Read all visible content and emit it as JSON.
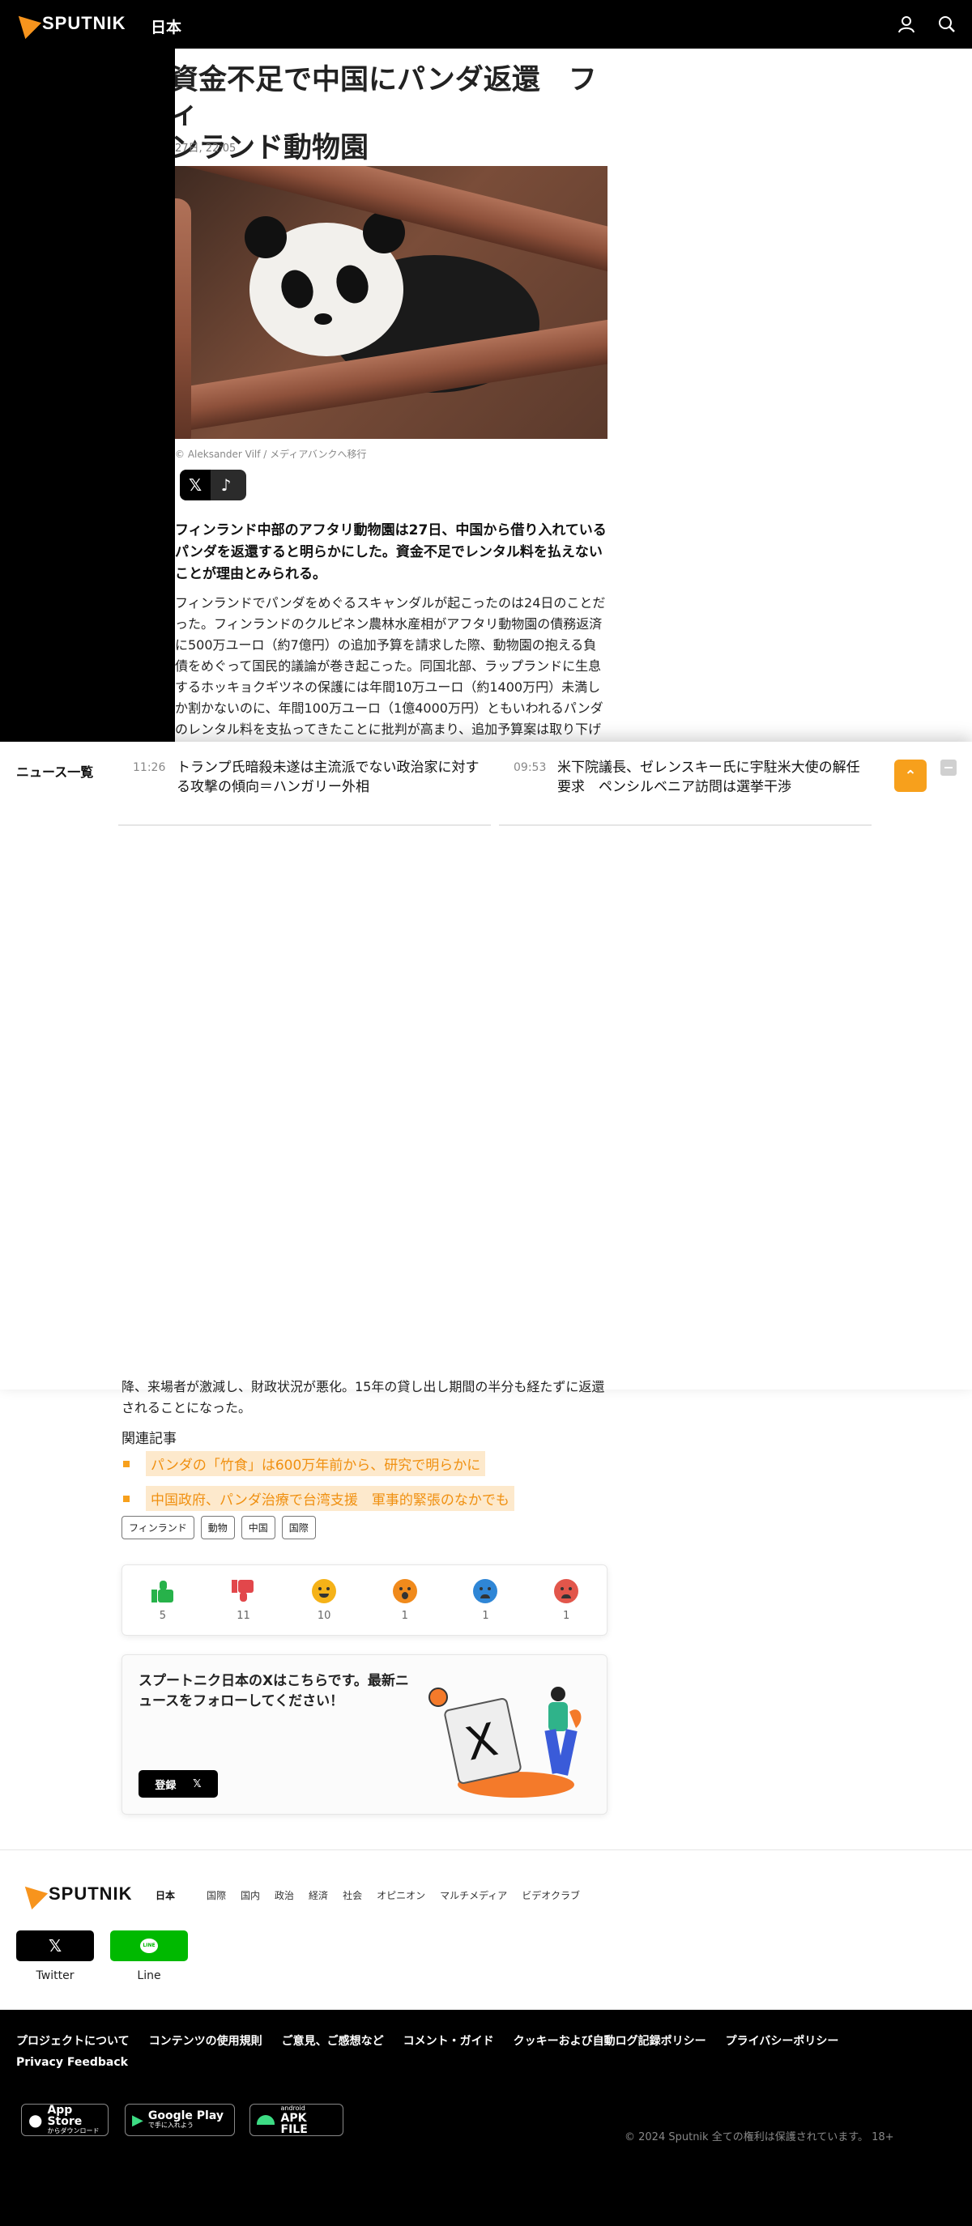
{
  "header": {
    "brand": "SPUTNIK",
    "edition": "日本",
    "user_icon": "user-icon",
    "search_icon": "search-icon"
  },
  "article": {
    "title_line1": "資金不足で中国にパンダ返還　フィ",
    "title_line2": "ンランド動物園",
    "date": "27日, 22:05",
    "caption": "© Aleksander Vilf / メディアバンクへ移行",
    "lead": "フィンランド中部のアフタリ動物園は27日、中国から借り入れているパンダを返還すると明らかにした。資金不足でレンタル料を払えないことが理由とみられる。",
    "body": "フィンランドでパンダをめぐるスキャンダルが起こったのは24日のことだった。フィンランドのクルピネン農林水産相がアフタリ動物園の債務返済に500万ユーロ（約7億円）の追加予算を請求した際、動物園の抱える負債をめぐって国民的議論が巻き起こった。同国北部、ラップランドに生息するホッキョクギツネの保護には年間10万ユーロ（約1400万円）未満しか割かないのに、年間100万ユーロ（1億4000万円）ともいわれるパンダのレンタル料を支払ってきたことに批判が高まり、追加予算案は取り下げに追い込まれた。",
    "body_tail": "降、来場者が激減し、財政状況が悪化。15年の貸し出し期間の半分も経たずに返還されることになった。"
  },
  "news_panel": {
    "label": "ニュース一覧",
    "items": [
      {
        "time": "11:26",
        "text": "トランプ氏暗殺未遂は主流派でない政治家に対する攻撃の傾向＝ハンガリー外相"
      },
      {
        "time": "09:53",
        "text": "米下院議長、ゼレンスキー氏に宇駐米大使の解任要求　ペンシルベニア訪問は選挙干渉"
      }
    ]
  },
  "related": {
    "title": "関連記事",
    "items": [
      "パンダの「竹食」は600万年前から、研究で明らかに",
      "中国政府、パンダ治療で台湾支援　軍事的緊張のなかでも"
    ]
  },
  "tags": [
    "フィンランド",
    "動物",
    "中国",
    "国際"
  ],
  "reactions": [
    {
      "icon": "thumbs-up-icon",
      "count": "5",
      "color": "#27b24a"
    },
    {
      "icon": "thumbs-down-icon",
      "count": "11",
      "color": "#e2474b"
    },
    {
      "icon": "laughing-face-icon",
      "count": "10",
      "color": "#f5b218"
    },
    {
      "icon": "surprised-face-icon",
      "count": "1",
      "color": "#f08a1c"
    },
    {
      "icon": "sad-face-icon",
      "count": "1",
      "color": "#2f86d6"
    },
    {
      "icon": "angry-face-icon",
      "count": "1",
      "color": "#e2564b"
    }
  ],
  "promo": {
    "text": "スプートニク日本のXはこちらです。最新ニュースをフォローしてください！",
    "button": "登録"
  },
  "footer": {
    "brand": "SPUTNIK",
    "edition": "日本",
    "nav": [
      "国際",
      "国内",
      "政治",
      "経済",
      "社会",
      "オピニオン",
      "マルチメディア",
      "ビデオクラブ"
    ],
    "social": [
      {
        "label": "Twitter",
        "icon": "x-icon",
        "color": "#000000"
      },
      {
        "label": "Line",
        "icon": "line-icon",
        "color": "#00b900"
      }
    ],
    "links": [
      "プロジェクトについて",
      "コンテンツの使用規則",
      "ご意見、ご感想など",
      "コメント・ガイド",
      "クッキーおよび自動ログ記録ポリシー",
      "プライバシーポリシー",
      "Privacy Feedback"
    ],
    "apps": [
      {
        "big": "App Store",
        "small": "からダウンロード",
        "icon": "apple-icon"
      },
      {
        "big": "Google Play",
        "small": "で手に入れよう",
        "icon": "google-play-icon"
      },
      {
        "big": "APK FILE",
        "small": "android",
        "icon": "android-icon"
      }
    ],
    "copyright": "© 2024 Sputnik 全ての権利は保護されています。 18+"
  },
  "colors": {
    "accent": "#f7a01c",
    "header_bg": "#000000"
  }
}
